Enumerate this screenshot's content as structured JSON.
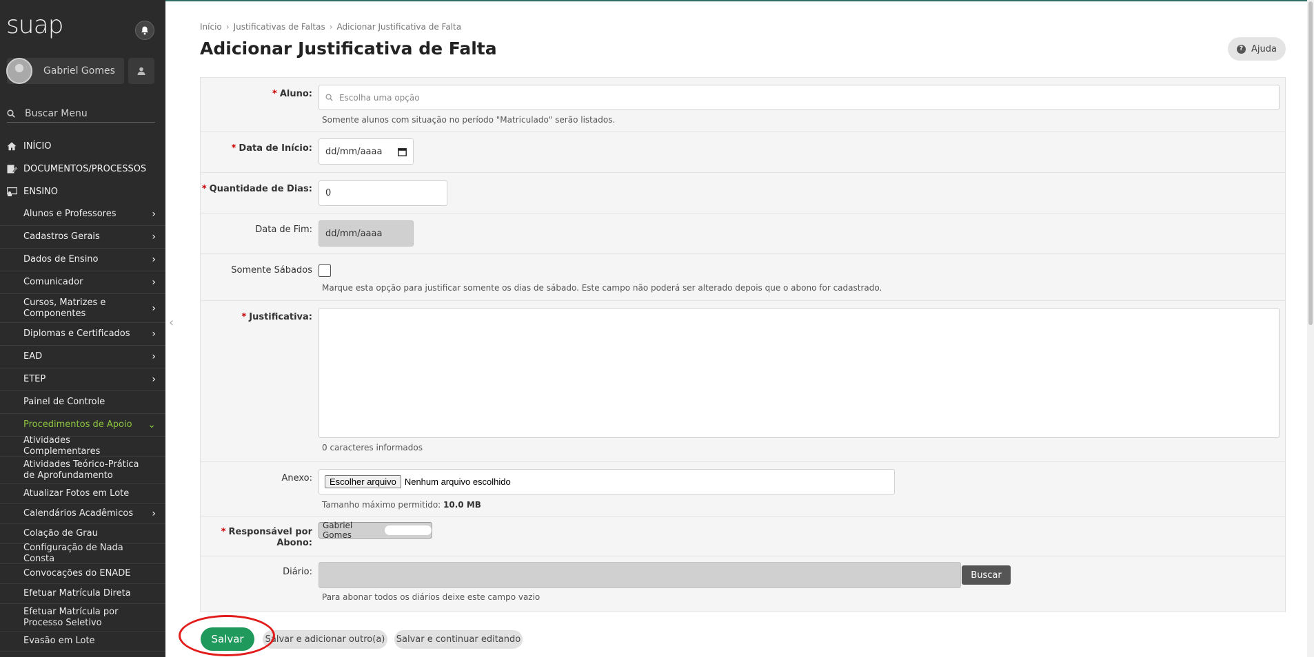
{
  "app": {
    "logo": "suap"
  },
  "user": {
    "name": "Gabriel Gomes"
  },
  "search": {
    "placeholder": "Buscar Menu"
  },
  "menu": {
    "top": [
      "INÍCIO",
      "DOCUMENTOS/PROCESSOS",
      "ENSINO"
    ],
    "ensino_items": [
      "Alunos e Professores",
      "Cadastros Gerais",
      "Dados de Ensino",
      "Comunicador",
      "Cursos, Matrizes e Componentes",
      "Diplomas e Certificados",
      "EAD",
      "ETEP",
      "Painel de Controle",
      "Procedimentos de Apoio"
    ],
    "apoio_items": [
      "Atividades Complementares",
      "Atividades Teórico-Prática de Aprofundamento",
      "Atualizar Fotos em Lote",
      "Calendários Acadêmicos",
      "Colação de Grau",
      "Configuração de Nada Consta",
      "Convocações do ENADE",
      "Efetuar Matrícula Direta",
      "Efetuar Matrícula por Processo Seletivo",
      "Evasão em Lote"
    ]
  },
  "breadcrumb": [
    "Início",
    "Justificativas de Faltas",
    "Adicionar Justificativa de Falta"
  ],
  "page": {
    "title": "Adicionar Justificativa de Falta",
    "help_label": "Ajuda"
  },
  "form": {
    "aluno": {
      "label": "Aluno:",
      "placeholder": "Escolha uma opção",
      "help": "Somente alunos com situação no período \"Matriculado\" serão listados."
    },
    "data_inicio": {
      "label": "Data de Início:",
      "value": "dd/mm/aaaa"
    },
    "quantidade": {
      "label": "Quantidade de Dias:",
      "value": "0"
    },
    "data_fim": {
      "label": "Data de Fim:",
      "value": "dd/mm/aaaa"
    },
    "sabados": {
      "label": "Somente Sábados",
      "help": "Marque esta opção para justificar somente os dias de sábado. Este campo não poderá ser alterado depois que o abono for cadastrado."
    },
    "justificativa": {
      "label": "Justificativa:",
      "help": "0 caracteres informados"
    },
    "anexo": {
      "label": "Anexo:",
      "button": "Escolher arquivo",
      "status": "Nenhum arquivo escolhido",
      "help_prefix": "Tamanho máximo permitido:",
      "help_value": "10.0 MB"
    },
    "responsavel": {
      "label_line1": "Responsável por",
      "label_line2": "Abono:",
      "value": "Gabriel Gomes"
    },
    "diario": {
      "label": "Diário:",
      "button": "Buscar",
      "help": "Para abonar todos os diários deixe este campo vazio"
    }
  },
  "actions": {
    "save": "Salvar",
    "save_add": "Salvar e adicionar outro(a)",
    "save_continue": "Salvar e continuar editando"
  }
}
